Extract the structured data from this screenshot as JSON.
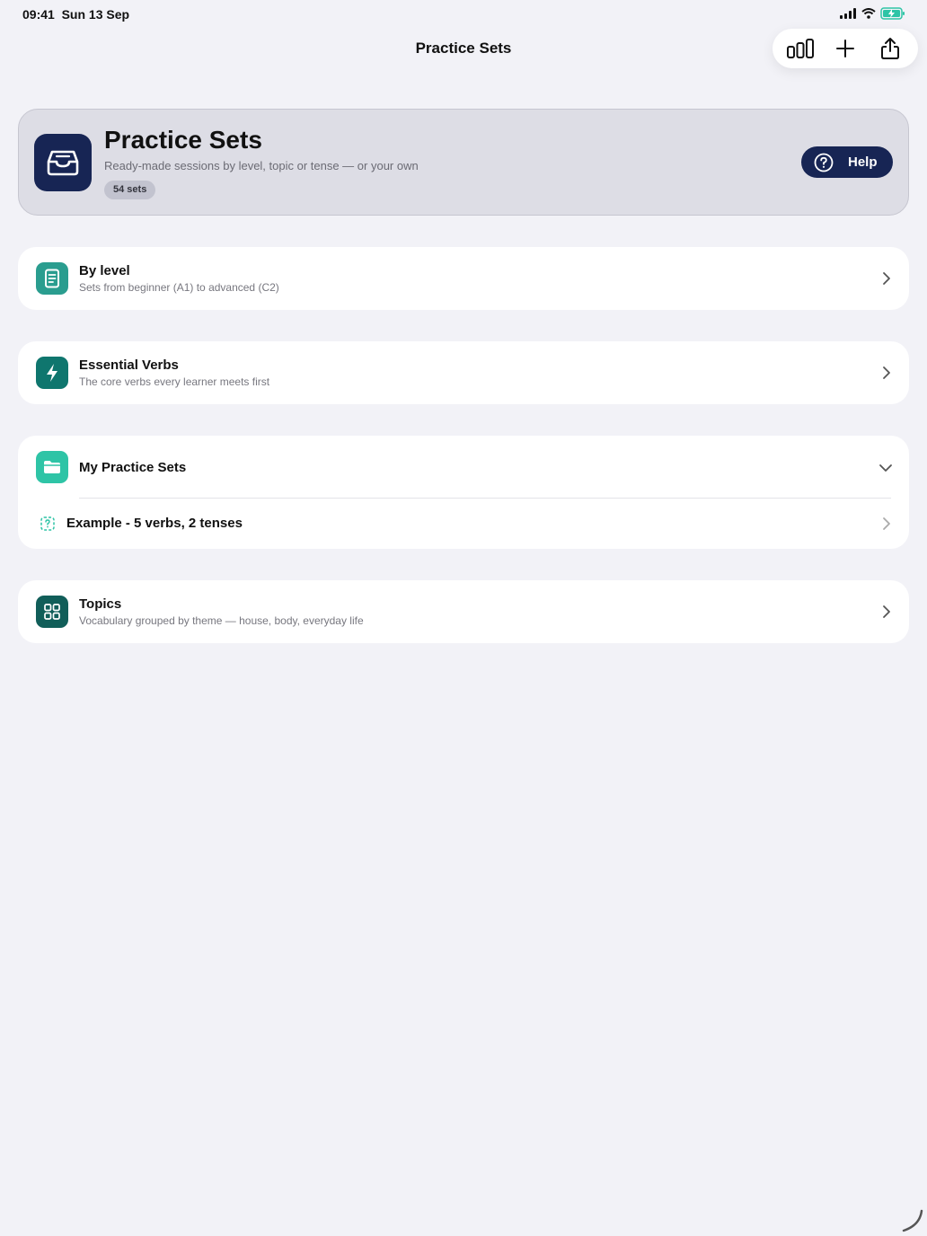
{
  "status": {
    "time": "09:41",
    "date": "Sun 13 Sep"
  },
  "nav": {
    "title": "Practice Sets",
    "toolbar": [
      "stats-icon",
      "plus-icon",
      "share-icon"
    ]
  },
  "hero": {
    "title": "Practice Sets",
    "subtitle": "Ready-made sessions by level, topic or tense — or your own",
    "badge": "54 sets",
    "help_label": "Help",
    "icon": "inbox-tray-icon"
  },
  "sections": {
    "by_level": {
      "title": "By level",
      "subtitle": "Sets from beginner (A1) to advanced (C2)",
      "icon": "document-icon",
      "color": "#2a9d8f"
    },
    "essential_verbs": {
      "title": "Essential Verbs",
      "subtitle": "The core verbs every learner meets first",
      "icon": "bolt-icon",
      "color": "#0f766e"
    },
    "my_sets": {
      "title": "My Practice Sets",
      "icon": "folder-icon",
      "color": "#2ec4a6",
      "items": [
        {
          "title": "Example - 5 verbs, 2 tenses",
          "icon": "dashed-question-icon"
        }
      ]
    },
    "topics": {
      "title": "Topics",
      "subtitle": "Vocabulary grouped by theme — house, body, everyday life",
      "icon": "grid-icon",
      "color": "#115e59"
    }
  },
  "colors": {
    "background": "#f2f2f7",
    "hero_bg": "#dddde5",
    "navy": "#172554"
  }
}
